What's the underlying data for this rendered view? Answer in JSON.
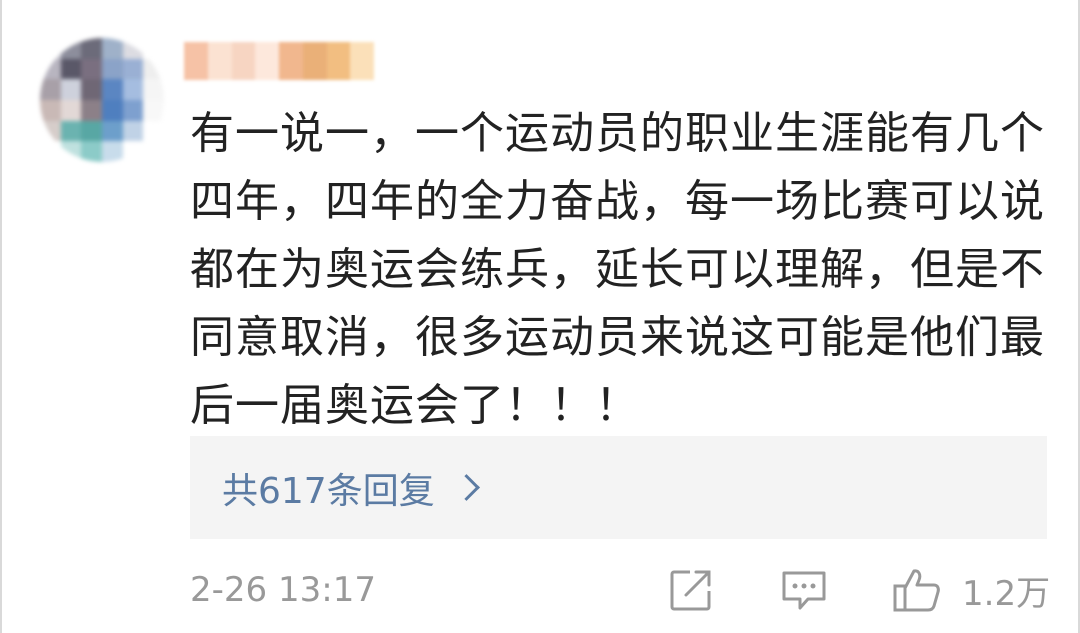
{
  "comment": {
    "avatar_colors": [
      "#c9c9d2",
      "#8d8e9c",
      "#6c6b7a",
      "#9fb1c9",
      "#dcdce2",
      "#ffffff",
      "#b8b5c0",
      "#5a5868",
      "#7a6f80",
      "#8ba3c8",
      "#9ab0d4",
      "#eeeeee",
      "#a8a0a8",
      "#ced1dc",
      "#6f6775",
      "#5b86c2",
      "#a5bde0",
      "#f5f5f5",
      "#c9b9b6",
      "#e2d8d6",
      "#8c8088",
      "#4f7fbf",
      "#7ea0cf",
      "#f8f8f8",
      "#d6cdca",
      "#6bb3b0",
      "#58a7a4",
      "#6d9fcb",
      "#c0d2e6",
      "#ffffff",
      "#ffffff",
      "#bfe1df",
      "#8ccbc8",
      "#c8dceb",
      "#ffffff",
      "#ffffff"
    ],
    "username_colors": [
      "#f6c2a6",
      "#fbe2d2",
      "#f7d5c2",
      "#fde8dc",
      "#f1b78e",
      "#eab078",
      "#f2be81",
      "#fbe0b9"
    ],
    "text": "有一说一，一个运动员的职业生涯能有几个四年，四年的全力奋战，每一场比赛可以说都在为奥运会练兵，延长可以理解，但是不同意取消，很多运动员来说这可能是他们最后一届奥运会了！！！",
    "replies_label": "共617条回复",
    "timestamp": "2-26 13:17",
    "like_count": "1.2万",
    "icons": {
      "share": "share-icon",
      "comment": "comment-icon",
      "like": "thumbs-up-icon",
      "replies_arrow": "chevron-right-icon"
    },
    "colors": {
      "text": "#222222",
      "link": "#5b7ba3",
      "meta": "#999999",
      "reply_bg": "#f4f4f4"
    }
  }
}
